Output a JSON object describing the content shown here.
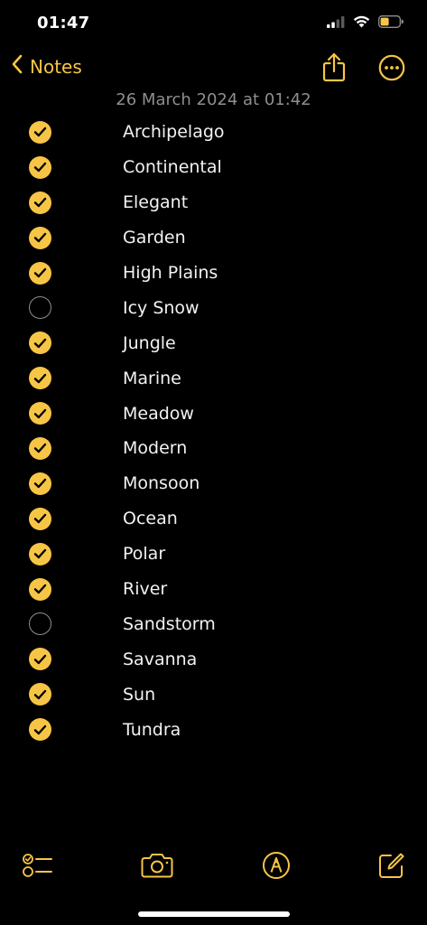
{
  "status_bar": {
    "time": "01:47"
  },
  "nav": {
    "back_label": "Notes"
  },
  "note": {
    "date": "26 March 2024 at 01:42",
    "items": [
      {
        "label": "Archipelago",
        "checked": true
      },
      {
        "label": "Continental",
        "checked": true
      },
      {
        "label": "Elegant",
        "checked": true
      },
      {
        "label": "Garden",
        "checked": true
      },
      {
        "label": "High Plains",
        "checked": true
      },
      {
        "label": "Icy Snow",
        "checked": false
      },
      {
        "label": "Jungle",
        "checked": true
      },
      {
        "label": "Marine",
        "checked": true
      },
      {
        "label": "Meadow",
        "checked": true
      },
      {
        "label": "Modern",
        "checked": true
      },
      {
        "label": "Monsoon",
        "checked": true
      },
      {
        "label": "Ocean",
        "checked": true
      },
      {
        "label": "Polar",
        "checked": true
      },
      {
        "label": "River",
        "checked": true
      },
      {
        "label": "Sandstorm",
        "checked": false
      },
      {
        "label": "Savanna",
        "checked": true
      },
      {
        "label": "Sun",
        "checked": true
      },
      {
        "label": "Tundra",
        "checked": true
      }
    ]
  },
  "colors": {
    "accent": "#f7c546",
    "background": "#000000",
    "secondary_text": "#8e8e93"
  },
  "icons": {
    "nav": [
      "chevron-left-icon",
      "share-icon",
      "more-icon"
    ],
    "toolbar": [
      "checklist-icon",
      "camera-icon",
      "markup-icon",
      "compose-icon"
    ]
  }
}
